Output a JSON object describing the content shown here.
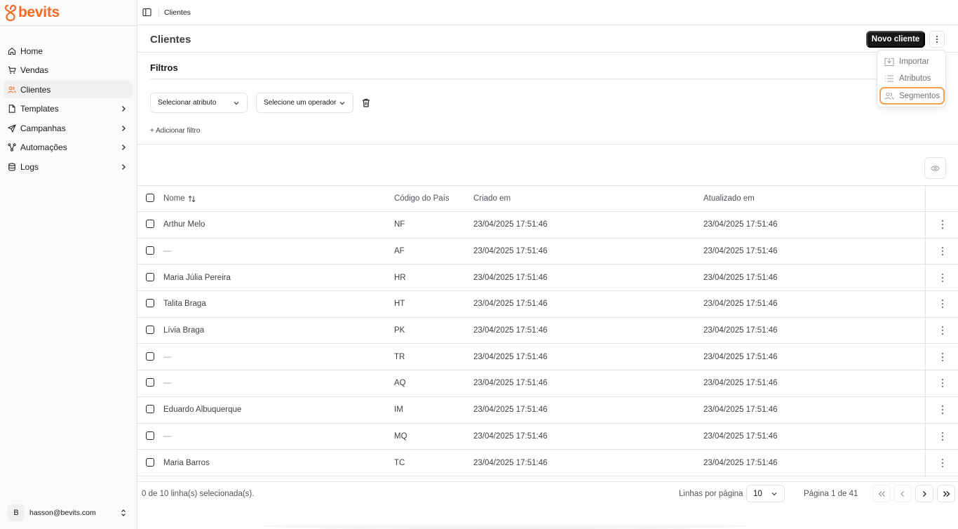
{
  "app": {
    "logo_text": "bevits",
    "brand_color": "#f26b2a"
  },
  "sidebar": {
    "items": [
      {
        "label": "Home",
        "icon": "home-icon",
        "active": false,
        "chevron": false
      },
      {
        "label": "Vendas",
        "icon": "cart-icon",
        "active": false,
        "chevron": false
      },
      {
        "label": "Clientes",
        "icon": "users-icon",
        "active": true,
        "chevron": false
      },
      {
        "label": "Templates",
        "icon": "file-icon",
        "active": false,
        "chevron": true
      },
      {
        "label": "Campanhas",
        "icon": "send-icon",
        "active": false,
        "chevron": true
      },
      {
        "label": "Automações",
        "icon": "workflow-icon",
        "active": false,
        "chevron": true
      },
      {
        "label": "Logs",
        "icon": "database-icon",
        "active": false,
        "chevron": true
      }
    ],
    "user": {
      "initial": "B",
      "email": "hasson@bevits.com"
    }
  },
  "topbar": {
    "breadcrumb": "Clientes"
  },
  "header": {
    "title": "Clientes",
    "new_button": "Novo cliente"
  },
  "menu": {
    "items": [
      {
        "label": "Importar",
        "icon": "import-icon"
      },
      {
        "label": "Atributos",
        "icon": "list-icon"
      },
      {
        "label": "Segmentos",
        "icon": "users-icon"
      }
    ],
    "highlight_color": "#f5a04c"
  },
  "filters": {
    "title": "Filtros",
    "attribute_placeholder": "Selecionar atributo",
    "operator_placeholder": "Selecione um operador",
    "add_filter": "+ Adicionar filtro"
  },
  "table": {
    "columns": {
      "name": "Nome",
      "country": "Código do País",
      "created": "Criado em",
      "updated": "Atualizado em"
    },
    "rows": [
      {
        "name": "Arthur Melo",
        "country": "NF",
        "created": "23/04/2025 17:51:46",
        "updated": "23/04/2025 17:51:46"
      },
      {
        "name": "—",
        "country": "AF",
        "created": "23/04/2025 17:51:46",
        "updated": "23/04/2025 17:51:46"
      },
      {
        "name": "Maria Júlia Pereira",
        "country": "HR",
        "created": "23/04/2025 17:51:46",
        "updated": "23/04/2025 17:51:46"
      },
      {
        "name": "Talita Braga",
        "country": "HT",
        "created": "23/04/2025 17:51:46",
        "updated": "23/04/2025 17:51:46"
      },
      {
        "name": "Lívia Braga",
        "country": "PK",
        "created": "23/04/2025 17:51:46",
        "updated": "23/04/2025 17:51:46"
      },
      {
        "name": "—",
        "country": "TR",
        "created": "23/04/2025 17:51:46",
        "updated": "23/04/2025 17:51:46"
      },
      {
        "name": "—",
        "country": "AQ",
        "created": "23/04/2025 17:51:46",
        "updated": "23/04/2025 17:51:46"
      },
      {
        "name": "Eduardo Albuquerque",
        "country": "IM",
        "created": "23/04/2025 17:51:46",
        "updated": "23/04/2025 17:51:46"
      },
      {
        "name": "—",
        "country": "MQ",
        "created": "23/04/2025 17:51:46",
        "updated": "23/04/2025 17:51:46"
      },
      {
        "name": "Maria Barros",
        "country": "TC",
        "created": "23/04/2025 17:51:46",
        "updated": "23/04/2025 17:51:46"
      }
    ]
  },
  "footer": {
    "selected_text": "0 de 10 linha(s) selecionada(s).",
    "rows_per_page_label": "Linhas por página",
    "rows_per_page_value": "10",
    "page_text": "Página 1 de 41"
  }
}
